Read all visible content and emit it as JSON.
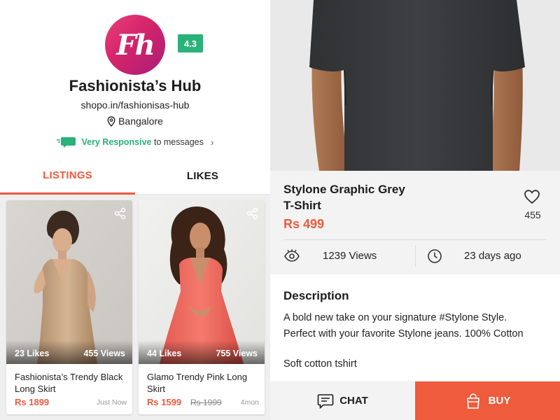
{
  "shop": {
    "logo_text": "Fh",
    "rating": "4.3",
    "name": "Fashionista’s Hub",
    "url": "shopo.in/fashionisas-hub",
    "location": "Bangalore",
    "responsive_highlight": "Very Responsive",
    "responsive_rest": "to messages"
  },
  "tabs": {
    "listings": "LISTINGS",
    "likes": "LIKES",
    "active": "LISTINGS"
  },
  "listings": [
    {
      "likes": "23 Likes",
      "views": "455 Views",
      "title": "Fashionista’s Trendy Black Long Skirt",
      "price": "Rs 1899",
      "mrp": "",
      "age": "Just Now"
    },
    {
      "likes": "44 Likes",
      "views": "755 Views",
      "title": "Glamo Trendy Pink Long Skirt",
      "price": "Rs 1599",
      "mrp": "Rs 1999",
      "age": "4mon"
    }
  ],
  "product": {
    "title_line1": "Stylone Graphic Grey",
    "title_line2": "T-Shirt",
    "price": "Rs 499",
    "likes": "455",
    "views": "1239 Views",
    "posted": "23 days ago",
    "description_heading": "Description",
    "description_line1": "A bold new take on your signature #Stylone Style.",
    "description_line2": "Perfect with your favorite Stylone jeans. 100% Cotton",
    "description_line3": "Soft cotton tshirt"
  },
  "actions": {
    "chat": "CHAT",
    "buy": "BUY"
  },
  "colors": {
    "accent": "#ef5a3c",
    "rating_green": "#2bb17a",
    "buy_button": "#ee5b3d",
    "logo_pink": "#d4246a"
  },
  "icons": [
    "location-pin-icon",
    "chat-bubble-icon",
    "chevron-right-icon",
    "share-icon",
    "heart-icon",
    "eye-icon",
    "clock-icon",
    "chat-icon",
    "shopping-bag-icon"
  ]
}
